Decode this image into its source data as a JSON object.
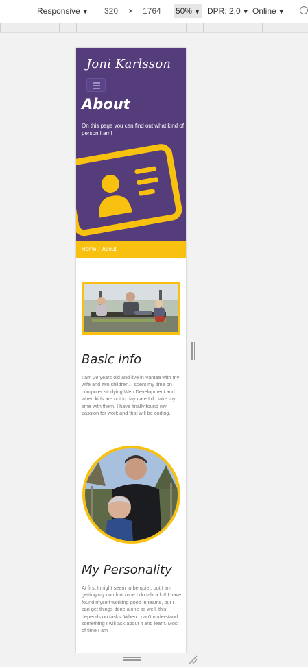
{
  "devtools": {
    "device": "Responsive",
    "width": "320",
    "times": "×",
    "height": "1764",
    "zoom": "50%",
    "dpr": "DPR: 2.0",
    "network": "Online",
    "caret": "▼"
  },
  "site": {
    "title": "Joni Karlsson"
  },
  "hero": {
    "heading": "About",
    "intro": "On this page you can find out what kind of person I am!"
  },
  "breadcrumb": {
    "home": "Home",
    "separator": "/",
    "current": "About"
  },
  "basic_info": {
    "heading": "Basic info",
    "text": "I am 29 years old and live in Vantaa with my wife and two children. I spent my time on computer studying Web Development and when kids are not in day care I do take my time with them. I have finally found my passion for work and that will be coding."
  },
  "personality": {
    "heading": "My Personality",
    "text": "At first I might seem to be quiet, but I am getting my comfort zone I do talk a lot! I have found myself working good in teams, but I can get things done alone as well, this depends on tasks. When I can't understand something I will ask about it and learn. Most of time I am"
  },
  "colors": {
    "brand_purple": "#553c7b",
    "accent_yellow": "#f8c10f"
  },
  "icons": {
    "hero_icon": "id-card-icon",
    "menu_icon": "hamburger-menu-icon"
  }
}
